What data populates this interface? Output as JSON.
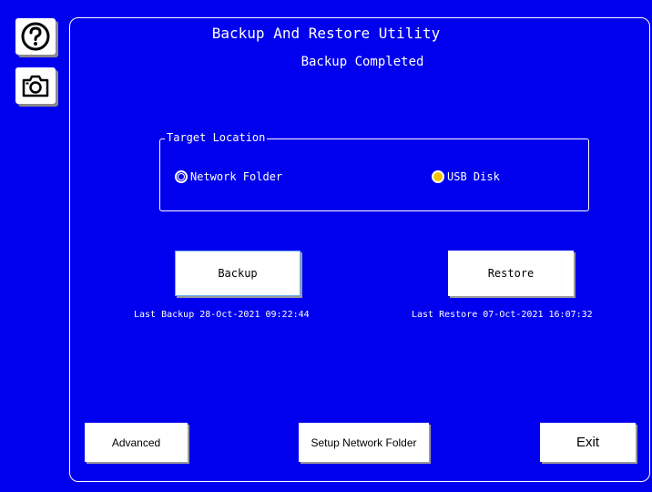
{
  "sidebar": {
    "help_icon": "question-circle-icon",
    "camera_icon": "camera-icon"
  },
  "header": {
    "title": "Backup And Restore Utility",
    "status": "Backup Completed"
  },
  "target": {
    "legend": "Target Location",
    "options": [
      {
        "label": "Network Folder",
        "selected": false
      },
      {
        "label": "USB Disk",
        "selected": true
      }
    ]
  },
  "actions": {
    "backup_label": "Backup",
    "restore_label": "Restore",
    "last_backup": "Last Backup 28-Oct-2021 09:22:44",
    "last_restore": "Last Restore 07-Oct-2021 16:07:32"
  },
  "footer": {
    "advanced_label": "Advanced",
    "setup_label": "Setup Network Folder",
    "exit_label": "Exit"
  },
  "colors": {
    "background": "#0000ee",
    "selected_radio": "#f5c400"
  }
}
